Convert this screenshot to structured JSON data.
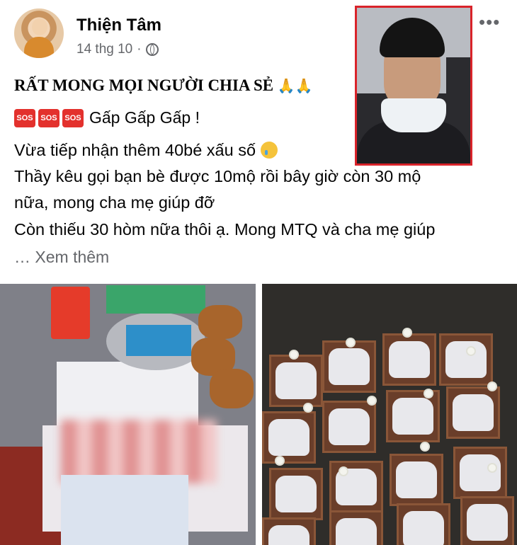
{
  "post": {
    "author_name": "Thiện Tâm",
    "timestamp": "14 thg 10",
    "timestamp_separator": "·",
    "more_options": "•••",
    "title": "RẤT MONG MỌI NGƯỜI CHIA SẺ",
    "title_emoji": "🙏🙏",
    "sos_label": "SOS",
    "urgent_text": "Gấp Gấp Gấp !",
    "lines": [
      "Vừa tiếp nhận thêm 40bé xấu số",
      "Thầy kêu gọi bạn bè được 10mộ rồi bây giờ còn 30 mộ",
      "nữa, mong cha mẹ giúp đỡ",
      "Còn thiếu 30 hòm nữa thôi ạ. Mong MTQ và cha mẹ giúp"
    ],
    "see_more": "… Xem thêm"
  },
  "colors": {
    "highlight_border": "#d9232a",
    "sos_red": "#e3312d",
    "secondary_text": "#65676b"
  }
}
